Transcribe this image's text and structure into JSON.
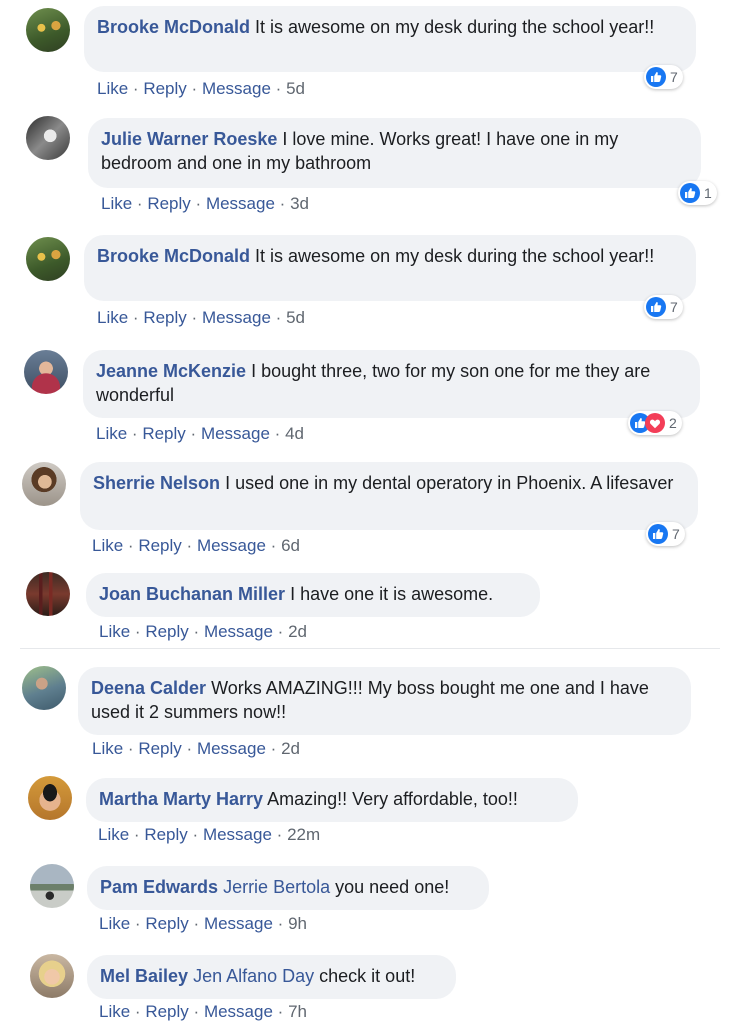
{
  "actions": {
    "like": "Like",
    "reply": "Reply",
    "message": "Message",
    "sep": "·"
  },
  "comments": [
    {
      "author": "Brooke McDonald",
      "text": "It is awesome on my desk during the school year!!",
      "time": "5d",
      "reactions": "7"
    },
    {
      "author": "Julie Warner Roeske",
      "text": "I love mine. Works great! I have one in my bedroom and one in my bathroom",
      "time": "3d",
      "reactions": "1"
    },
    {
      "author": "Brooke McDonald",
      "text": "It is awesome on my desk during the school year!!",
      "time": "5d",
      "reactions": "7"
    },
    {
      "author": "Jeanne McKenzie",
      "text": "I bought three, two for my son one for me they are wonderful",
      "time": "4d",
      "reactions": "2"
    },
    {
      "author": "Sherrie Nelson",
      "text": "I used one in my dental operatory in Phoenix. A lifesaver",
      "time": "6d",
      "reactions": "7"
    },
    {
      "author": "Joan Buchanan Miller",
      "text": "I have one it is awesome.",
      "time": "2d"
    },
    {
      "author": "Deena Calder",
      "text": "Works AMAZING!!! My boss bought me one and I have used it 2 summers now!!",
      "time": "2d"
    },
    {
      "author": "Martha Marty Harry",
      "text": "Amazing!! Very affordable, too!!",
      "time": "22m"
    },
    {
      "author": "Pam Edwards",
      "tag": "Jerrie Bertola",
      "text": "you need one!",
      "time": "9h"
    },
    {
      "author": "Mel Bailey",
      "tag": "Jen Alfano Day",
      "text": "check it out!",
      "time": "7h"
    }
  ],
  "colors": {
    "link": "#385898",
    "bubble": "#f0f2f5",
    "like_blue": "#1877f2",
    "love_red": "#f33e58"
  }
}
